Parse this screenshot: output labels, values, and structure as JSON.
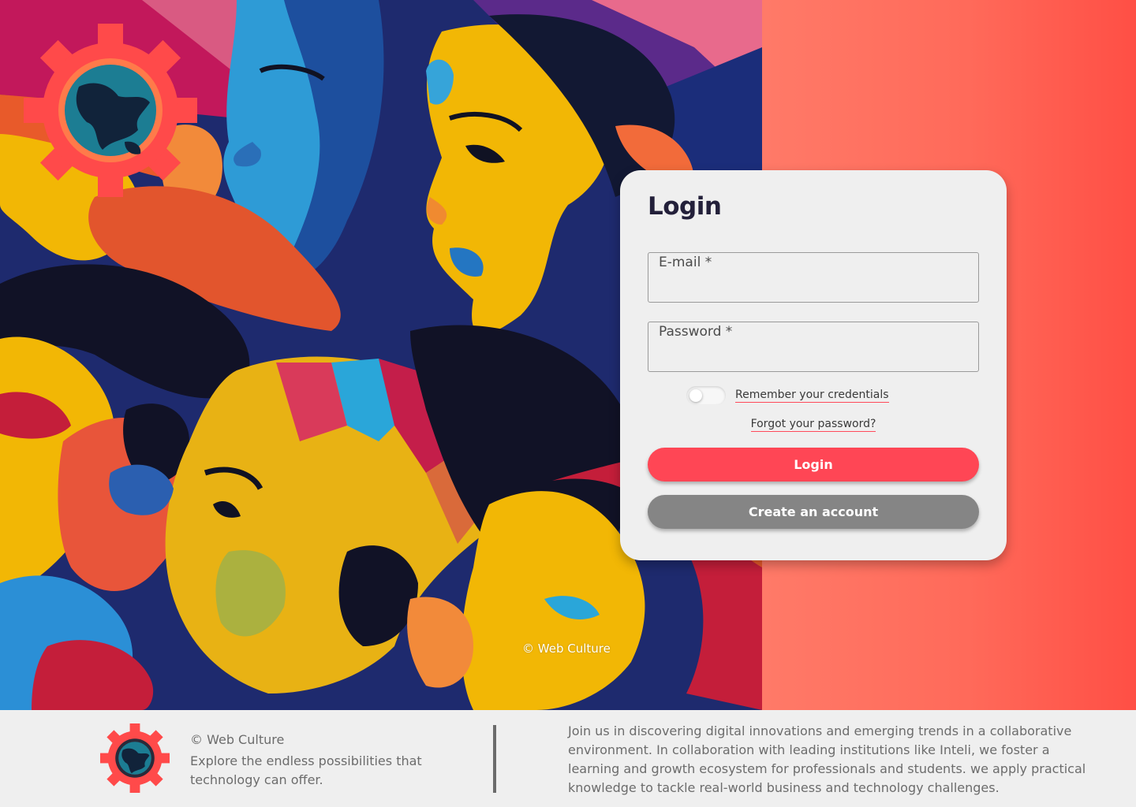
{
  "brand": {
    "name": "Web Culture",
    "logo_icon": "gear-globe-icon",
    "colors": {
      "accent": "#ff4655",
      "gradient_start": "#ff7a68",
      "gradient_end": "#ff4f45",
      "secondary_button": "#858585",
      "title": "#23203a"
    }
  },
  "hero": {
    "art_credit": "© Web Culture"
  },
  "login": {
    "title": "Login",
    "email_label": "E-mail *",
    "email_value": "",
    "password_label": "Password *",
    "password_value": "",
    "remember_label": "Remember your credentials",
    "remember_checked": false,
    "forgot_label": "Forgot your password?",
    "login_button": "Login",
    "create_account_button": "Create an account"
  },
  "footer": {
    "copyright": "© Web Culture",
    "tagline": "Explore the endless possibilities that technology can offer.",
    "about": "Join us in discovering digital innovations and emerging trends in a collaborative environment. In collaboration with leading institutions like Inteli, we foster a learning and growth ecosystem for professionals and students. we apply practical knowledge to tackle real-world business and technology challenges."
  }
}
